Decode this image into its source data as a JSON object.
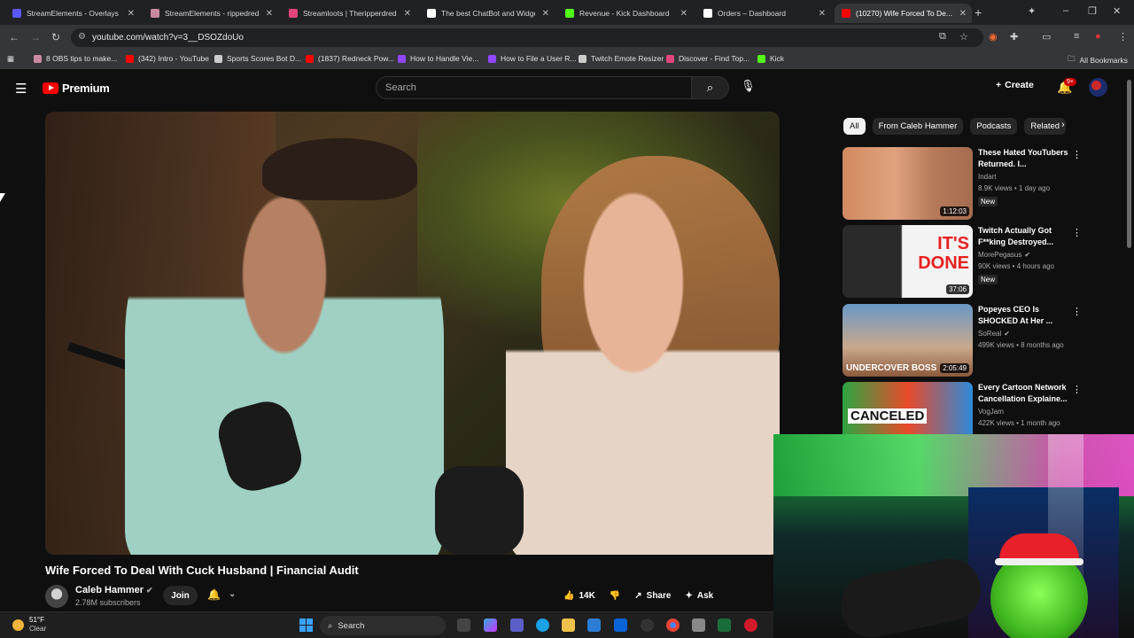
{
  "tabs": [
    {
      "title": "StreamElements - Overlays",
      "color": "#5b58ff",
      "active": false
    },
    {
      "title": "StreamElements - rippedredne...",
      "color": "#c98aa0",
      "active": false
    },
    {
      "title": "Streamloots | Theripperdredne...",
      "color": "#e2457b",
      "active": false
    },
    {
      "title": "The best ChatBot and Widgets...",
      "color": "#ffffff",
      "active": false
    },
    {
      "title": "Revenue - Kick Dashboard",
      "color": "#53fc18",
      "active": false
    },
    {
      "title": "Orders – Dashboard",
      "color": "#ffffff",
      "active": false
    },
    {
      "title": "(10270) Wife Forced To De...",
      "color": "#ff0000",
      "active": true
    }
  ],
  "url": "youtube.com/watch?v=3__DSOZdoUo",
  "bookmarks": [
    {
      "label": "8 OBS tips to make...",
      "color": "#c98aa0"
    },
    {
      "label": "(342) Intro - YouTube",
      "color": "#ff0000"
    },
    {
      "label": "Sports Scores Bot D...",
      "color": "#cccccc"
    },
    {
      "label": "(1837) Redneck Pow...",
      "color": "#ff0000"
    },
    {
      "label": "How to Handle Vie...",
      "color": "#9146ff"
    },
    {
      "label": "How to File a User R...",
      "color": "#9146ff"
    },
    {
      "label": "Twitch Emote Resizer",
      "color": "#cccccc"
    },
    {
      "label": "Discover - Find Top...",
      "color": "#e2457b"
    },
    {
      "label": "Kick",
      "color": "#53fc18"
    }
  ],
  "all_bookmarks": "All Bookmarks",
  "yt": {
    "logo_text": "Premium",
    "search_placeholder": "Search",
    "create_label": "Create",
    "notif_count": "9+"
  },
  "video": {
    "title": "Wife Forced To Deal With Cuck Husband | Financial Audit",
    "channel": "Caleb Hammer",
    "subs": "2.78M subscribers",
    "join": "Join",
    "likes": "14K",
    "share": "Share",
    "ask": "Ask"
  },
  "chips": [
    "All",
    "From Caleb Hammer",
    "Podcasts",
    "Related"
  ],
  "recs": [
    {
      "title": "These Hated YouTubers Returned. I...",
      "channel": "Indart",
      "verified": false,
      "meta": "8.9K views • 1 day ago",
      "badge": "New",
      "duration": "1:12:03",
      "thumb_text": ""
    },
    {
      "title": "Twitch Actually Got F**king Destroyed...",
      "channel": "MorePegasus",
      "verified": true,
      "meta": "90K views • 4 hours ago",
      "badge": "New",
      "duration": "37:06",
      "thumb_text": "IT'S DONE"
    },
    {
      "title": "Popeyes CEO Is SHOCKED At Her ...",
      "channel": "SoReal",
      "verified": true,
      "meta": "499K views • 8 months ago",
      "badge": "",
      "duration": "2:05:49",
      "thumb_text": "UNDERCOVER BOSS"
    },
    {
      "title": "Every Cartoon Network Cancellation Explaine...",
      "channel": "VogJam",
      "verified": false,
      "meta": "422K views • 1 month ago",
      "badge": "",
      "duration": "",
      "thumb_text": "CANCELED"
    }
  ],
  "taskbar": {
    "temp": "51°F",
    "condition": "Clear",
    "search": "Search"
  }
}
